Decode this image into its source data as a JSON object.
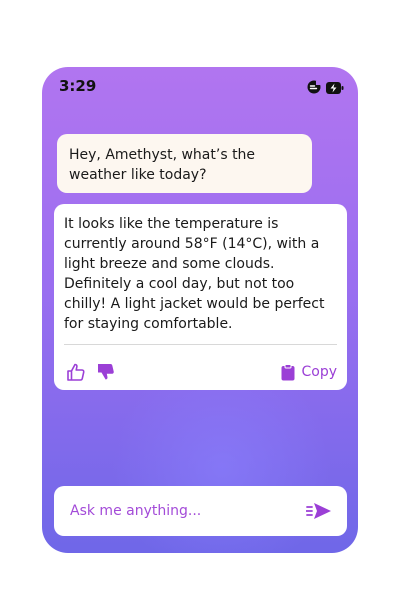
{
  "status_bar": {
    "time": "3:29",
    "icons": [
      "activity-icon",
      "battery-charging-icon"
    ]
  },
  "conversation": {
    "user_message": "Hey, Amethyst, what’s the weather like today?",
    "assistant_reply": "It looks like the temperature is currently around 58°F (14°C), with a light breeze and some clouds. Definitely a cool day, but not too chilly! A light jacket would be perfect for staying comfortable."
  },
  "actions": {
    "like_icon": "thumbs-up-icon",
    "dislike_icon": "thumbs-down-icon",
    "copy_icon": "clipboard-icon",
    "copy_label": "Copy"
  },
  "input": {
    "placeholder": "Ask me anything...",
    "send_icon": "send-icon"
  },
  "colors": {
    "accent": "#9b3fd6",
    "gradient_top": "#b175f0",
    "gradient_bottom": "#6f67e8"
  }
}
